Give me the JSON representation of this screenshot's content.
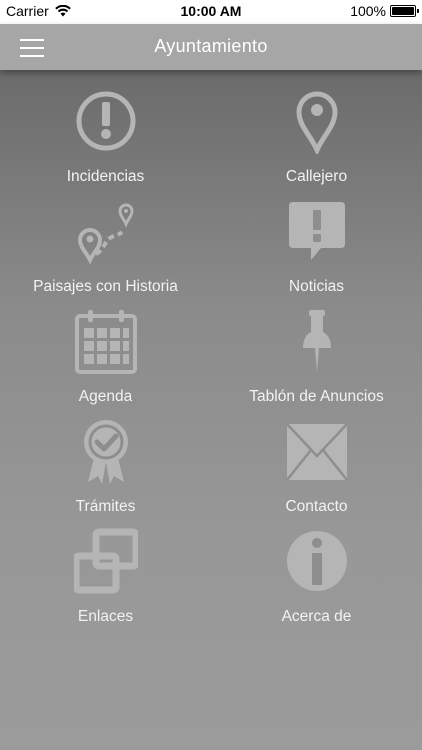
{
  "status_bar": {
    "carrier": "Carrier",
    "time": "10:00 AM",
    "battery": "100%"
  },
  "nav": {
    "title": "Ayuntamiento",
    "menu_icon": "hamburger-menu-icon"
  },
  "colors": {
    "icon": "#b5b5b5",
    "label": "#f2f2f2",
    "nav_bar": "#a6a6a6"
  },
  "menu": [
    {
      "label": "Incidencias",
      "icon": "exclamation-circle-icon"
    },
    {
      "label": "Callejero",
      "icon": "map-pin-icon"
    },
    {
      "label": "Paisajes con Historia",
      "icon": "route-pins-icon"
    },
    {
      "label": "Noticias",
      "icon": "news-alert-bubble-icon"
    },
    {
      "label": "Agenda",
      "icon": "calendar-icon"
    },
    {
      "label": "Tablón de Anuncios",
      "icon": "pushpin-icon"
    },
    {
      "label": "Trámites",
      "icon": "certificate-badge-icon"
    },
    {
      "label": "Contacto",
      "icon": "envelope-icon"
    },
    {
      "label": "Enlaces",
      "icon": "links-icon"
    },
    {
      "label": "Acerca de",
      "icon": "info-circle-icon"
    }
  ]
}
